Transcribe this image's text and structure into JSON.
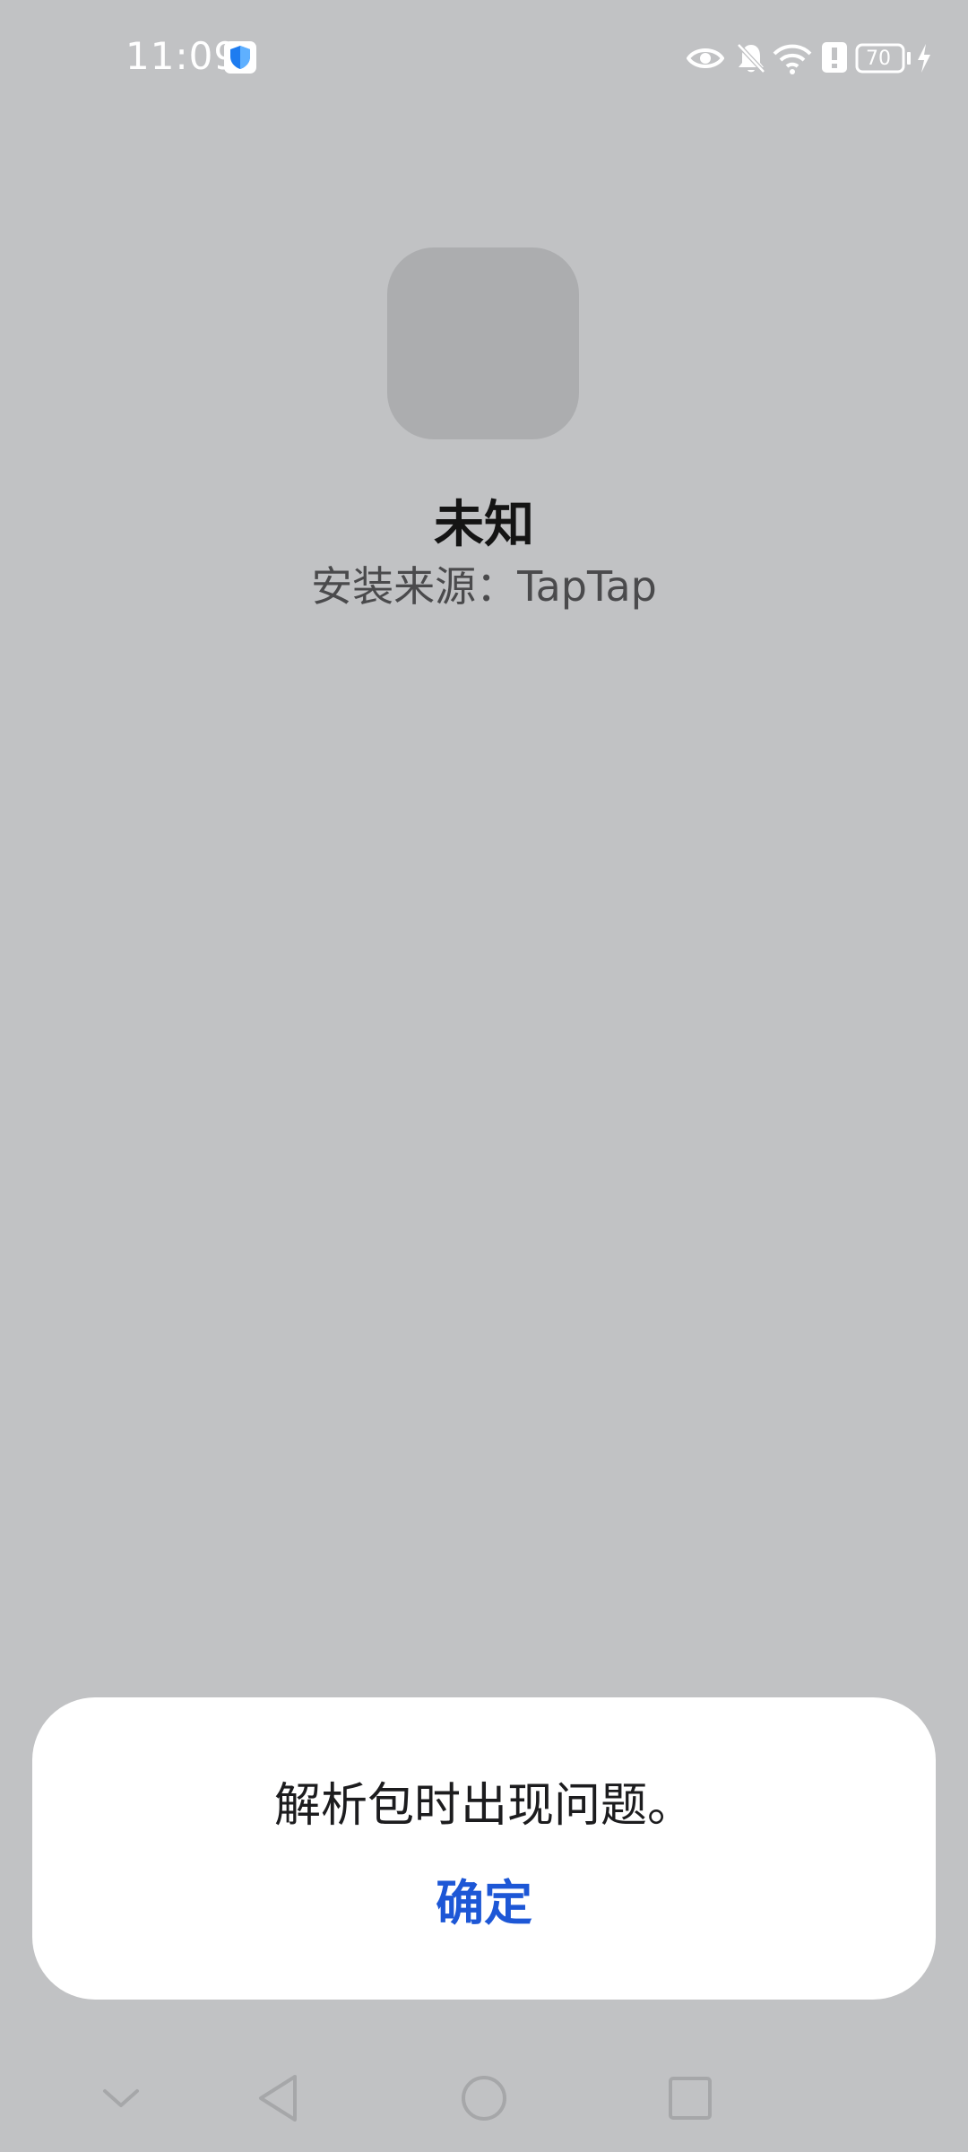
{
  "status_bar": {
    "time": "11:09",
    "battery_level": "70",
    "icons": [
      "shield-icon",
      "eye-icon",
      "bell-off-icon",
      "wifi-icon",
      "alert-icon",
      "battery-icon",
      "charging-icon"
    ]
  },
  "app": {
    "name": "未知",
    "install_source": "安装来源：TapTap"
  },
  "dialog": {
    "message": "解析包时出现问题。",
    "confirm_label": "确定"
  },
  "nav_bar": {
    "icons": [
      "chevron-down-icon",
      "back-icon",
      "home-icon",
      "recents-icon"
    ]
  },
  "colors": {
    "background": "#c1c2c4",
    "icon_placeholder": "#acadaf",
    "dialog_background": "#ffffff",
    "accent": "#1d57d6",
    "nav_icon": "#a6a7a9"
  }
}
